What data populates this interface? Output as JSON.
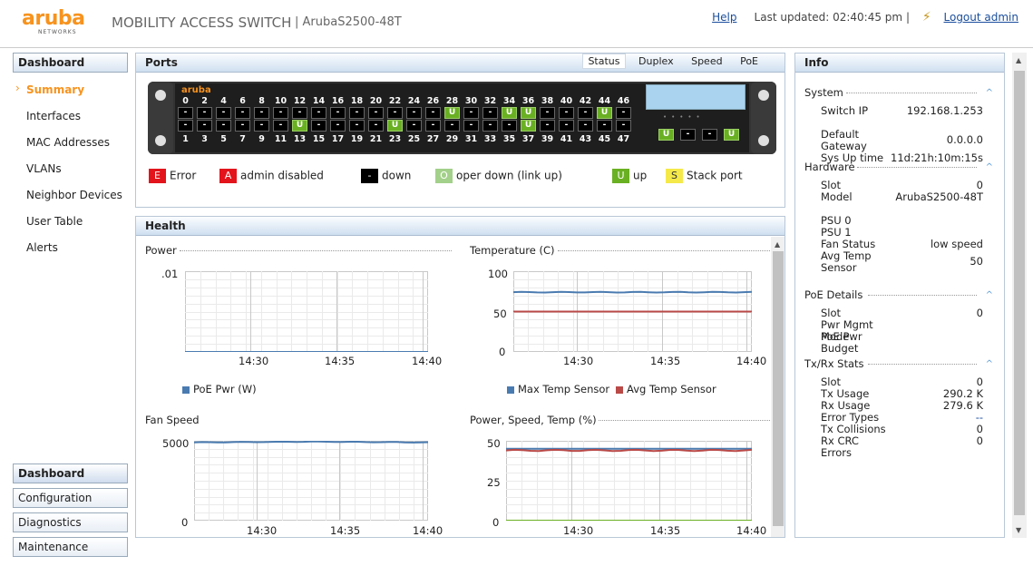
{
  "header": {
    "logo_word": "aruba",
    "logo_sub": "NETWORKS",
    "app_title": "MOBILITY ACCESS SWITCH",
    "model_sep": "|",
    "model": "ArubaS2500-48T",
    "help": "Help",
    "last_updated": "Last updated: 02:40:45 pm",
    "divider": "|",
    "logout": "Logout admin"
  },
  "sidebar": {
    "section_title": "Dashboard",
    "items": [
      {
        "label": "Summary",
        "active": true
      },
      {
        "label": "Interfaces"
      },
      {
        "label": "MAC Addresses"
      },
      {
        "label": "VLANs"
      },
      {
        "label": "Neighbor Devices"
      },
      {
        "label": "User Table"
      },
      {
        "label": "Alerts"
      }
    ],
    "bottom": [
      {
        "label": "Dashboard",
        "selected": true
      },
      {
        "label": "Configuration"
      },
      {
        "label": "Diagnostics"
      },
      {
        "label": "Maintenance"
      }
    ]
  },
  "ports": {
    "title": "Ports",
    "tabs": [
      "Status",
      "Duplex",
      "Speed",
      "PoE"
    ],
    "active_tab": "Status",
    "top_numbers": [
      "0",
      "2",
      "4",
      "6",
      "8",
      "10",
      "12",
      "14",
      "16",
      "18",
      "20",
      "22",
      "24",
      "26",
      "28",
      "30",
      "32",
      "34",
      "36",
      "38",
      "40",
      "42",
      "44",
      "46"
    ],
    "bottom_numbers": [
      "1",
      "3",
      "5",
      "7",
      "9",
      "11",
      "13",
      "15",
      "17",
      "19",
      "21",
      "23",
      "25",
      "27",
      "29",
      "31",
      "33",
      "35",
      "37",
      "39",
      "41",
      "43",
      "45",
      "47"
    ],
    "top_row": [
      "-",
      "-",
      "-",
      "-",
      "-",
      "-",
      "-",
      "-",
      "-",
      "-",
      "-",
      "-",
      "-",
      "-",
      "U",
      "-",
      "-",
      "U",
      "U",
      "-",
      "-",
      "-",
      "U",
      "-"
    ],
    "bottom_row": [
      "-",
      "-",
      "-",
      "-",
      "-",
      "-",
      "U",
      "-",
      "-",
      "-",
      "-",
      "U",
      "-",
      "-",
      "-",
      "-",
      "-",
      "-",
      "U",
      "-",
      "-",
      "-",
      "-",
      "-"
    ],
    "uplinks": [
      "U",
      "-",
      "-",
      "U"
    ],
    "legend": [
      {
        "code": "E",
        "label": "Error",
        "color": "#e3141b"
      },
      {
        "code": "A",
        "label": "admin disabled",
        "color": "#e3141b"
      },
      {
        "code": "-",
        "label": "down",
        "color": "#000000"
      },
      {
        "code": "O",
        "label": "oper down (link up)",
        "color": "#a3d08a"
      },
      {
        "code": "U",
        "label": "up",
        "color": "#6ab023"
      },
      {
        "code": "S",
        "label": "Stack port",
        "color": "#f5e94a"
      }
    ]
  },
  "health": {
    "title": "Health",
    "charts": {
      "power": {
        "title": "Power",
        "y_ticks": [
          ".01"
        ],
        "x_ticks": [
          "14:30",
          "14:35",
          "14:40"
        ],
        "legend": [
          {
            "name": "PoE Pwr (W)",
            "color": "#4a7bb0"
          }
        ]
      },
      "temperature": {
        "title": "Temperature (C)",
        "y_ticks": [
          "100",
          "50",
          "0"
        ],
        "x_ticks": [
          "14:30",
          "14:35",
          "14:40"
        ],
        "legend": [
          {
            "name": "Max Temp Sensor",
            "color": "#4a7bb0"
          },
          {
            "name": "Avg Temp Sensor",
            "color": "#b94a48"
          }
        ]
      },
      "fan": {
        "title": "Fan Speed",
        "y_ticks": [
          "5000",
          "0"
        ],
        "x_ticks": [
          "14:30",
          "14:35",
          "14:40"
        ]
      },
      "pst": {
        "title": "Power, Speed, Temp (%)",
        "y_ticks": [
          "50",
          "25",
          "0"
        ],
        "x_ticks": [
          "14:30",
          "14:35",
          "14:40"
        ]
      }
    }
  },
  "chart_data": [
    {
      "type": "line",
      "title": "Power",
      "x": [
        "14:30",
        "14:35",
        "14:40"
      ],
      "series": [
        {
          "name": "PoE Pwr (W)",
          "values": [
            0,
            0,
            0
          ]
        }
      ],
      "ylim": [
        0,
        0.01
      ]
    },
    {
      "type": "line",
      "title": "Temperature (C)",
      "x": [
        "14:30",
        "14:35",
        "14:40"
      ],
      "series": [
        {
          "name": "Max Temp Sensor",
          "values": [
            74,
            74,
            74
          ]
        },
        {
          "name": "Avg Temp Sensor",
          "values": [
            50,
            50,
            50
          ]
        }
      ],
      "ylim": [
        0,
        100
      ]
    },
    {
      "type": "line",
      "title": "Fan Speed",
      "x": [
        "14:30",
        "14:35",
        "14:40"
      ],
      "series": [
        {
          "name": "",
          "values": [
            4900,
            4950,
            4900
          ]
        }
      ],
      "ylim": [
        0,
        5000
      ]
    },
    {
      "type": "line",
      "title": "Power, Speed, Temp (%)",
      "x": [
        "14:30",
        "14:35",
        "14:40"
      ],
      "series": [
        {
          "name": "",
          "values": [
            45,
            45,
            45
          ]
        },
        {
          "name": "",
          "values": [
            44,
            44,
            44
          ]
        },
        {
          "name": "",
          "values": [
            0,
            0,
            0
          ]
        }
      ],
      "ylim": [
        0,
        50
      ]
    }
  ],
  "info": {
    "title": "Info",
    "system": {
      "title": "System",
      "rows": [
        {
          "k": "Switch IP",
          "v": "192.168.1.253"
        },
        {
          "k": "Default Gateway",
          "v": "0.0.0.0"
        },
        {
          "k": "Sys Up time",
          "v": "11d:21h:10m:15s"
        }
      ]
    },
    "hardware": {
      "title": "Hardware",
      "rows": [
        {
          "k": "Slot",
          "v": "0"
        },
        {
          "k": "Model",
          "v": "ArubaS2500-48T"
        },
        {
          "k": "PSU 0",
          "v": ""
        },
        {
          "k": "PSU 1",
          "v": ""
        },
        {
          "k": "Fan Status",
          "v": "low speed"
        },
        {
          "k": "Avg Temp Sensor",
          "v": "50"
        }
      ]
    },
    "poe": {
      "title": "PoE Details",
      "rows": [
        {
          "k": "Slot",
          "v": "0"
        },
        {
          "k": "Pwr Mgmt Mode",
          "v": ""
        },
        {
          "k": "PoE Pwr Budget",
          "v": ""
        }
      ]
    },
    "txrx": {
      "title": "Tx/Rx Stats",
      "rows": [
        {
          "k": "Slot",
          "v": "0"
        },
        {
          "k": "Tx Usage",
          "v": "290.2 K"
        },
        {
          "k": "Rx Usage",
          "v": "279.6 K"
        },
        {
          "k": "Error Types",
          "v": "--"
        },
        {
          "k": "Tx Collisions",
          "v": "0"
        },
        {
          "k": "Rx CRC Errors",
          "v": "0"
        }
      ]
    }
  }
}
